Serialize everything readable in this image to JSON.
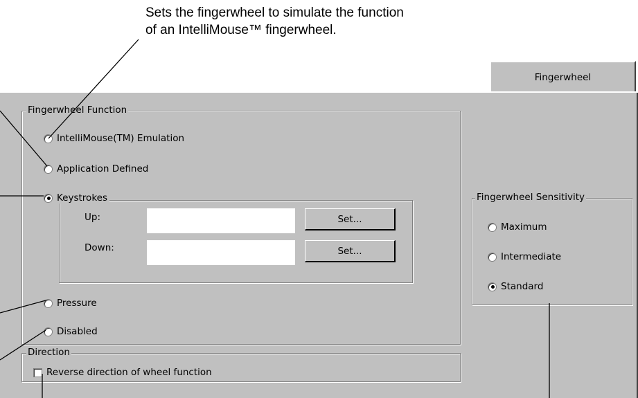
{
  "caption": {
    "line1": "Sets the fingerwheel to simulate the function",
    "line2": "of an IntelliMouse™ fingerwheel."
  },
  "tab": {
    "label": "Fingerwheel"
  },
  "function_group": {
    "title": "Fingerwheel Function",
    "options": {
      "intellimouse": {
        "label": "IntelliMouse(TM) Emulation",
        "selected": false
      },
      "application": {
        "label": "Application Defined",
        "selected": false
      },
      "keystrokes": {
        "label": "Keystrokes",
        "selected": true
      },
      "pressure": {
        "label": "Pressure",
        "selected": false
      },
      "disabled": {
        "label": "Disabled",
        "selected": false
      }
    },
    "keystrokes": {
      "up_label": "Up:",
      "up_value": "",
      "down_label": "Down:",
      "down_value": "",
      "set_up_label": "Set...",
      "set_down_label": "Set..."
    }
  },
  "direction_group": {
    "title": "Direction",
    "reverse_label": "Reverse direction of wheel function",
    "reverse_checked": false
  },
  "sensitivity_group": {
    "title": "Fingerwheel Sensitivity",
    "options": {
      "maximum": {
        "label": "Maximum",
        "selected": false
      },
      "intermediate": {
        "label": "Intermediate",
        "selected": false
      },
      "standard": {
        "label": "Standard",
        "selected": true
      }
    }
  },
  "colors": {
    "dialog": "#c0c0c0",
    "shadow": "#808080",
    "highlight": "#ffffff"
  }
}
